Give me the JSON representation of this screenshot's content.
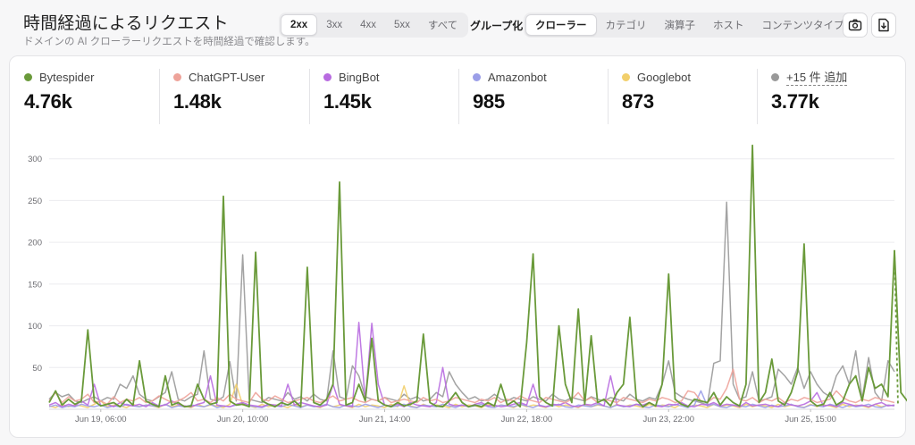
{
  "header": {
    "title": "時間経過によるリクエスト",
    "subtitle": "ドメインの AI クローラーリクエストを時間経過で確認します。"
  },
  "status_tabs": [
    {
      "label": "2xx",
      "active": true
    },
    {
      "label": "3xx",
      "active": false
    },
    {
      "label": "4xx",
      "active": false
    },
    {
      "label": "5xx",
      "active": false
    },
    {
      "label": "すべて",
      "active": false
    }
  ],
  "group_label": "グループ化:",
  "group_tabs": [
    {
      "label": "クローラー",
      "active": true
    },
    {
      "label": "カテゴリ",
      "active": false
    },
    {
      "label": "演算子",
      "active": false
    },
    {
      "label": "ホスト",
      "active": false
    },
    {
      "label": "コンテンツタイプ",
      "active": false
    }
  ],
  "toolbar": {
    "screenshot_icon": "camera-icon",
    "download_icon": "download-icon"
  },
  "stats": [
    {
      "name": "Bytespider",
      "value": "4.76k",
      "color": "#6a9a3a"
    },
    {
      "name": "ChatGPT-User",
      "value": "1.48k",
      "color": "#eea39a"
    },
    {
      "name": "BingBot",
      "value": "1.45k",
      "color": "#b86be0"
    },
    {
      "name": "Amazonbot",
      "value": "985",
      "color": "#9b9ee8"
    },
    {
      "name": "Googlebot",
      "value": "873",
      "color": "#f2cf6b"
    },
    {
      "name": "+15 件 追加",
      "value": "3.77k",
      "color": "#999999"
    }
  ],
  "chart_data": {
    "type": "line",
    "ylim": [
      0,
      320
    ],
    "yticks": [
      50,
      100,
      150,
      200,
      250,
      300
    ],
    "xtick_labels": [
      "Jun 19, 06:00",
      "Jun 20, 10:00",
      "Jun 21, 14:00",
      "Jun 22, 18:00",
      "Jun 23, 22:00",
      "Jun 25, 15:00"
    ],
    "xtick_index": [
      8,
      30,
      52,
      74,
      96,
      118
    ],
    "n_points": 132,
    "series": [
      {
        "name": "Bytespider",
        "color": "#6a9a3a",
        "values": [
          8,
          22,
          5,
          12,
          6,
          10,
          95,
          10,
          4,
          6,
          8,
          3,
          12,
          5,
          58,
          10,
          6,
          3,
          40,
          5,
          8,
          3,
          4,
          30,
          12,
          6,
          8,
          255,
          10,
          5,
          6,
          3,
          188,
          10,
          6,
          3,
          8,
          5,
          10,
          3,
          170,
          8,
          5,
          12,
          30,
          272,
          5,
          8,
          30,
          10,
          85,
          10,
          5,
          3,
          8,
          4,
          6,
          10,
          90,
          8,
          4,
          3,
          10,
          20,
          8,
          3,
          5,
          3,
          8,
          4,
          30,
          5,
          10,
          3,
          80,
          186,
          15,
          8,
          4,
          100,
          30,
          8,
          120,
          6,
          88,
          8,
          12,
          4,
          20,
          30,
          110,
          12,
          3,
          8,
          4,
          30,
          162,
          12,
          6,
          3,
          12,
          10,
          8,
          20,
          5,
          15,
          8,
          4,
          30,
          316,
          8,
          20,
          60,
          10,
          5,
          20,
          45,
          198,
          10,
          4,
          6,
          20,
          5,
          10,
          30,
          40,
          10,
          50,
          25,
          30,
          15,
          190,
          20,
          10,
          3,
          72,
          12
        ]
      },
      {
        "name": "ChatGPT-User",
        "color": "#eea39a",
        "values": [
          10,
          20,
          8,
          15,
          10,
          12,
          18,
          8,
          10,
          6,
          15,
          8,
          12,
          10,
          14,
          8,
          10,
          16,
          12,
          8,
          10,
          14,
          20,
          10,
          12,
          8,
          14,
          10,
          18,
          12,
          10,
          8,
          20,
          12,
          10,
          16,
          12,
          8,
          10,
          12,
          14,
          10,
          8,
          12,
          16,
          10,
          12,
          14,
          10,
          8,
          12,
          10,
          14,
          8,
          10,
          12,
          10,
          8,
          14,
          10,
          12,
          8,
          10,
          14,
          12,
          10,
          8,
          12,
          10,
          14,
          8,
          12,
          10,
          16,
          12,
          10,
          8,
          14,
          12,
          10,
          8,
          12,
          20,
          10,
          14,
          8,
          12,
          10,
          8,
          14,
          12,
          10,
          8,
          12,
          10,
          14,
          12,
          8,
          10,
          22,
          20,
          10,
          8,
          14,
          12,
          25,
          48,
          12,
          10,
          14,
          8,
          12,
          10,
          14,
          8,
          12,
          10,
          14,
          12,
          8,
          10,
          12,
          22,
          14,
          10,
          8,
          12,
          10,
          14,
          12,
          10,
          8
        ]
      },
      {
        "name": "BingBot",
        "color": "#b86be0",
        "values": [
          5,
          8,
          3,
          6,
          4,
          10,
          5,
          30,
          4,
          6,
          3,
          8,
          5,
          4,
          6,
          3,
          8,
          4,
          5,
          10,
          6,
          4,
          3,
          6,
          8,
          40,
          5,
          4,
          3,
          6,
          8,
          5,
          4,
          3,
          6,
          5,
          4,
          30,
          5,
          8,
          6,
          4,
          3,
          5,
          30,
          6,
          4,
          3,
          104,
          10,
          103,
          30,
          5,
          4,
          6,
          3,
          8,
          5,
          4,
          3,
          8,
          50,
          6,
          4,
          5,
          3,
          6,
          8,
          4,
          5,
          3,
          4,
          6,
          8,
          5,
          30,
          4,
          3,
          6,
          5,
          8,
          4,
          3,
          6,
          5,
          8,
          4,
          40,
          5,
          4,
          3,
          6,
          5,
          8,
          4,
          3,
          6,
          5,
          8,
          4,
          3,
          6,
          5,
          8,
          4,
          6,
          5,
          3,
          8,
          4,
          5,
          6,
          4,
          3,
          8,
          5,
          4,
          6,
          10,
          20,
          4,
          5,
          3,
          8,
          6,
          4,
          5,
          3,
          6,
          8,
          4,
          5
        ]
      },
      {
        "name": "Amazonbot",
        "color": "#9b9ee8",
        "values": [
          3,
          5,
          2,
          4,
          3,
          6,
          4,
          3,
          5,
          2,
          4,
          3,
          6,
          4,
          3,
          5,
          4,
          3,
          6,
          2,
          4,
          3,
          5,
          4,
          3,
          6,
          2,
          4,
          3,
          5,
          6,
          4,
          3,
          2,
          5,
          4,
          3,
          6,
          4,
          2,
          5,
          3,
          4,
          6,
          3,
          2,
          5,
          4,
          3,
          6,
          4,
          2,
          5,
          3,
          4,
          6,
          3,
          2,
          5,
          4,
          3,
          6,
          4,
          2,
          5,
          3,
          4,
          6,
          3,
          2,
          5,
          4,
          3,
          6,
          4,
          2,
          5,
          3,
          4,
          6,
          3,
          2,
          5,
          4,
          3,
          6,
          4,
          2,
          5,
          3,
          4,
          6,
          3,
          2,
          5,
          4,
          3,
          6,
          4,
          2,
          5,
          22,
          4,
          6,
          3,
          2,
          5,
          4,
          3,
          6,
          4,
          2,
          5,
          3,
          4,
          6,
          3,
          2,
          5,
          4,
          3,
          6,
          4,
          2,
          5,
          3,
          4,
          6,
          3,
          2,
          5,
          4
        ]
      },
      {
        "name": "Googlebot",
        "color": "#f2cf6b",
        "values": [
          4,
          2,
          6,
          3,
          5,
          4,
          2,
          6,
          10,
          3,
          5,
          4,
          2,
          6,
          3,
          5,
          4,
          2,
          6,
          3,
          5,
          4,
          2,
          6,
          3,
          5,
          4,
          2,
          6,
          30,
          5,
          4,
          2,
          6,
          3,
          5,
          4,
          2,
          6,
          3,
          5,
          4,
          2,
          6,
          3,
          5,
          4,
          2,
          6,
          3,
          5,
          4,
          2,
          6,
          3,
          28,
          4,
          2,
          6,
          3,
          5,
          4,
          2,
          6,
          3,
          5,
          4,
          2,
          6,
          3,
          5,
          4,
          2,
          6,
          3,
          5,
          4,
          2,
          6,
          3,
          5,
          4,
          2,
          6,
          3,
          5,
          4,
          2,
          6,
          3,
          5,
          4,
          2,
          6,
          3,
          5,
          4,
          2,
          6,
          3,
          5,
          4,
          2,
          6,
          3,
          5,
          4,
          2,
          6,
          3,
          5,
          4,
          2,
          6,
          3,
          5,
          4,
          2,
          6,
          3,
          5,
          4,
          2,
          6,
          3,
          5,
          4,
          2,
          6,
          3,
          5,
          4
        ]
      },
      {
        "name": "+15 件 追加",
        "color": "#999999",
        "values": [
          12,
          20,
          15,
          18,
          10,
          8,
          12,
          15,
          10,
          14,
          12,
          30,
          25,
          40,
          18,
          12,
          10,
          15,
          20,
          45,
          12,
          10,
          15,
          18,
          70,
          12,
          10,
          15,
          57,
          10,
          185,
          12,
          10,
          8,
          14,
          12,
          10,
          20,
          12,
          15,
          10,
          18,
          12,
          10,
          70,
          15,
          12,
          52,
          40,
          15,
          12,
          10,
          14,
          12,
          10,
          18,
          12,
          15,
          10,
          12,
          20,
          15,
          45,
          30,
          20,
          12,
          15,
          10,
          12,
          18,
          12,
          10,
          14,
          12,
          10,
          15,
          12,
          10,
          18,
          12,
          10,
          14,
          12,
          10,
          15,
          12,
          10,
          14,
          12,
          10,
          18,
          12,
          10,
          14,
          12,
          30,
          58,
          20,
          15,
          12,
          10,
          8,
          5,
          55,
          58,
          248,
          30,
          12,
          15,
          45,
          10,
          12,
          15,
          48,
          40,
          30,
          50,
          25,
          45,
          30,
          20,
          15,
          40,
          52,
          30,
          70,
          12,
          62,
          20,
          10,
          58,
          45
        ]
      }
    ]
  }
}
